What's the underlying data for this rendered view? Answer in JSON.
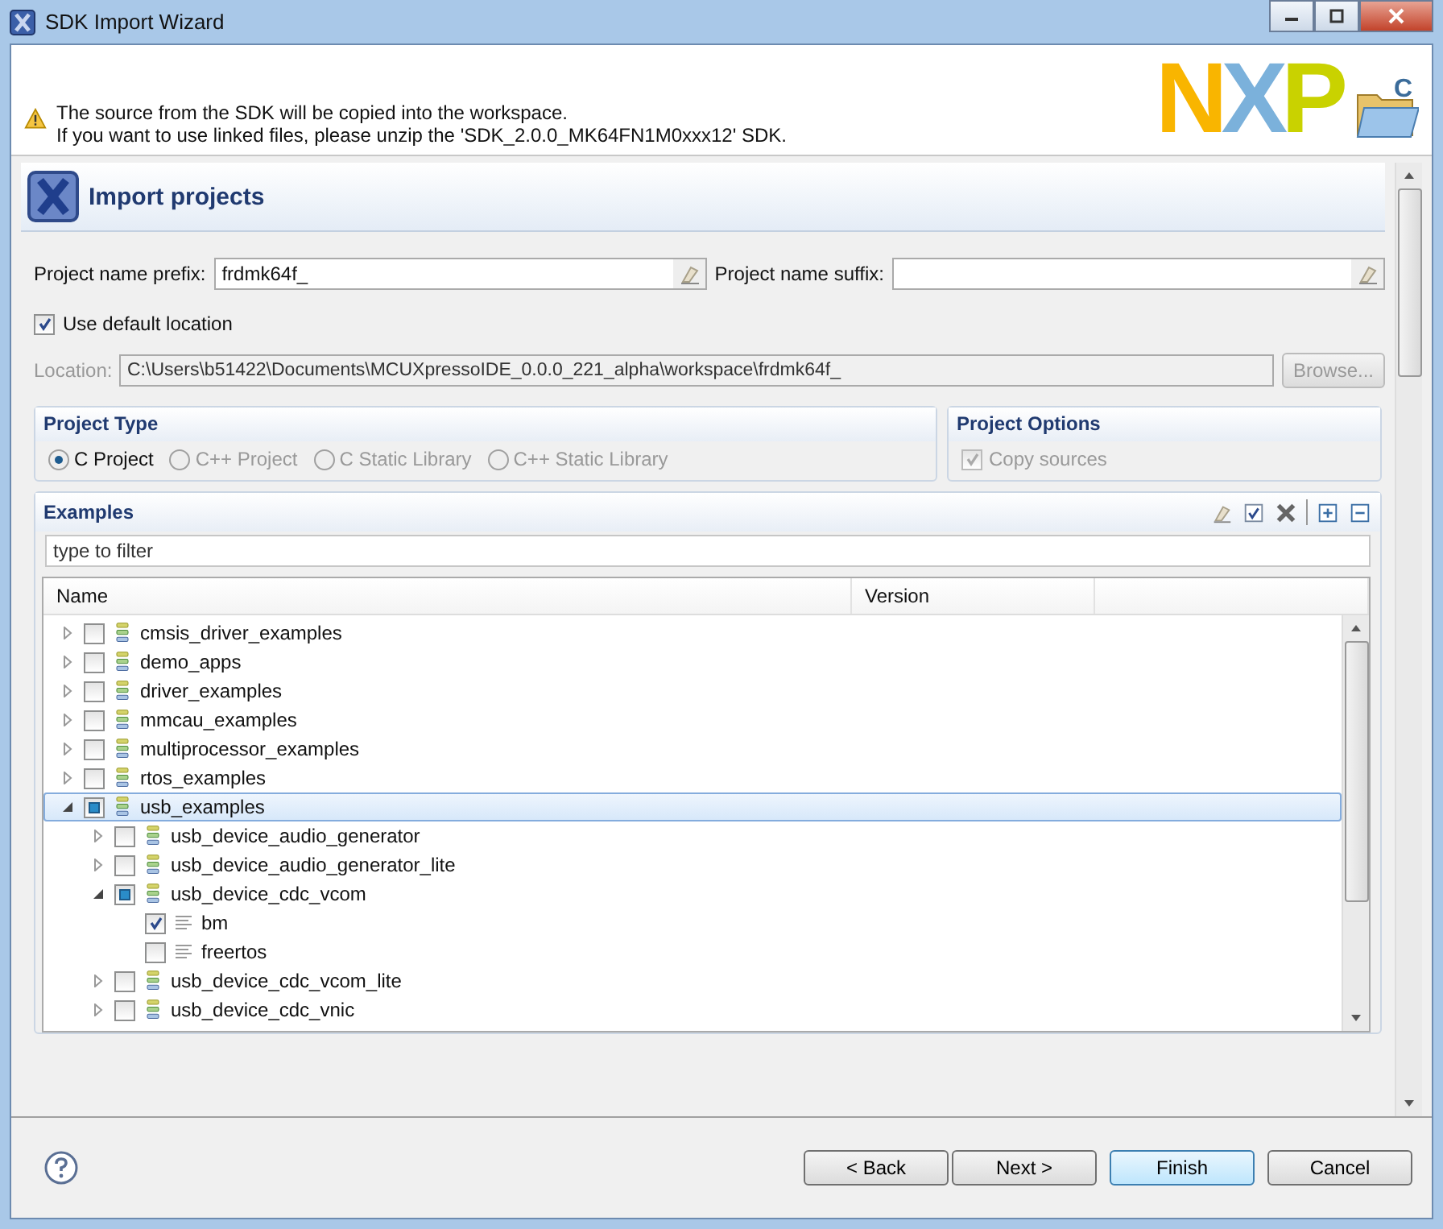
{
  "window": {
    "title": "SDK Import Wizard"
  },
  "header": {
    "message_lines": [
      "The source from the SDK will be copied into the workspace.",
      "If you want to use linked files, please unzip the 'SDK_2.0.0_MK64FN1M0xxx12' SDK."
    ],
    "logo": "NXP",
    "folder_badge": "C"
  },
  "banner": {
    "title": "Import projects"
  },
  "prefix": {
    "label": "Project name prefix:",
    "value": "frdmk64f_"
  },
  "suffix": {
    "label": "Project name suffix:"
  },
  "use_default_location": {
    "label": "Use default location",
    "checked": true
  },
  "location": {
    "label": "Location:",
    "value": "C:\\Users\\b51422\\Documents\\MCUXpressoIDE_0.0.0_221_alpha\\workspace\\frdmk64f_",
    "disabled": true,
    "button": "Browse..."
  },
  "project_type": {
    "title": "Project Type",
    "options": [
      {
        "label": "C Project",
        "selected": true
      },
      {
        "label": "C++ Project",
        "selected": false
      },
      {
        "label": "C Static Library",
        "selected": false
      },
      {
        "label": "C++ Static Library",
        "selected": false
      }
    ]
  },
  "project_options": {
    "title": "Project Options",
    "options": [
      {
        "label": "Copy sources",
        "checked": true,
        "disabled": true
      }
    ]
  },
  "examples": {
    "title": "Examples",
    "filter": {
      "placeholder": "type to filter"
    },
    "columns": [
      "Name",
      "Version"
    ],
    "tree": [
      {
        "name": "cmsis_driver_examples",
        "kind": "group",
        "expanded": false,
        "checked": false,
        "partial": false,
        "selected": false
      },
      {
        "name": "demo_apps",
        "kind": "group",
        "expanded": false,
        "checked": false,
        "partial": false,
        "selected": false
      },
      {
        "name": "driver_examples",
        "kind": "group",
        "expanded": false,
        "checked": false,
        "partial": false,
        "selected": false
      },
      {
        "name": "mmcau_examples",
        "kind": "group",
        "expanded": false,
        "checked": false,
        "partial": false,
        "selected": false
      },
      {
        "name": "multiprocessor_examples",
        "kind": "group",
        "expanded": false,
        "checked": false,
        "partial": false,
        "selected": false
      },
      {
        "name": "rtos_examples",
        "kind": "group",
        "expanded": false,
        "checked": false,
        "partial": false,
        "selected": false
      },
      {
        "name": "usb_examples",
        "kind": "group",
        "expanded": true,
        "checked": false,
        "partial": true,
        "selected": true,
        "children": [
          {
            "name": "usb_device_audio_generator",
            "kind": "group",
            "expanded": false,
            "checked": false,
            "partial": false,
            "selected": false
          },
          {
            "name": "usb_device_audio_generator_lite",
            "kind": "group",
            "expanded": false,
            "checked": false,
            "partial": false,
            "selected": false
          },
          {
            "name": "usb_device_cdc_vcom",
            "kind": "group",
            "expanded": true,
            "checked": false,
            "partial": true,
            "selected": false,
            "children": [
              {
                "name": "bm",
                "kind": "project",
                "checked": true,
                "partial": false,
                "selected": false
              },
              {
                "name": "freertos",
                "kind": "project",
                "checked": false,
                "partial": false,
                "selected": false
              }
            ]
          },
          {
            "name": "usb_device_cdc_vcom_lite",
            "kind": "group",
            "expanded": false,
            "checked": false,
            "partial": false,
            "selected": false
          },
          {
            "name": "usb_device_cdc_vnic",
            "kind": "group",
            "expanded": false,
            "checked": false,
            "partial": false,
            "selected": false
          }
        ]
      }
    ]
  },
  "buttons": [
    {
      "label": "< Back",
      "default": false
    },
    {
      "label": "Next >",
      "default": false
    },
    {
      "label": "Finish",
      "default": true
    },
    {
      "label": "Cancel",
      "default": false
    }
  ]
}
